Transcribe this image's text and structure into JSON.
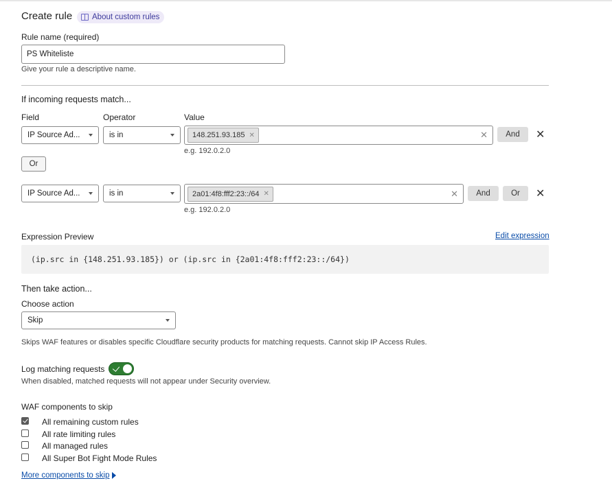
{
  "header": {
    "title": "Create rule",
    "about_link": "About custom rules"
  },
  "rule_name": {
    "label": "Rule name (required)",
    "value": "PS Whiteliste",
    "help": "Give your rule a descriptive name."
  },
  "match": {
    "heading": "If incoming requests match...",
    "columns": {
      "field": "Field",
      "operator": "Operator",
      "value": "Value"
    },
    "rows": [
      {
        "field": "IP Source Ad...",
        "operator": "is in",
        "chip": "148.251.93.185",
        "hint": "e.g. 192.0.2.0",
        "and_label": "And"
      },
      {
        "field": "IP Source Ad...",
        "operator": "is in",
        "chip": "2a01:4f8:fff2:23::/64",
        "hint": "e.g. 192.0.2.0",
        "and_label": "And",
        "or_label": "Or"
      }
    ],
    "or_label": "Or"
  },
  "expression": {
    "label": "Expression Preview",
    "edit_link": "Edit expression",
    "text": "(ip.src in {148.251.93.185}) or (ip.src in {2a01:4f8:fff2:23::/64})"
  },
  "action": {
    "heading": "Then take action...",
    "label": "Choose action",
    "selected": "Skip",
    "help": "Skips WAF features or disables specific Cloudflare security products for matching requests. Cannot skip IP Access Rules."
  },
  "log": {
    "label": "Log matching requests",
    "enabled": true,
    "help": "When disabled, matched requests will not appear under Security overview."
  },
  "waf": {
    "heading": "WAF components to skip",
    "items": [
      {
        "label": "All remaining custom rules",
        "checked": true
      },
      {
        "label": "All rate limiting rules",
        "checked": false
      },
      {
        "label": "All managed rules",
        "checked": false
      },
      {
        "label": "All Super Bot Fight Mode Rules",
        "checked": false
      }
    ],
    "more_link": "More components to skip"
  },
  "icons": {
    "about": "book-icon",
    "clear": "close-icon",
    "remove": "close-icon",
    "caret": "chevron-down-icon",
    "more": "triangle-right-icon"
  }
}
